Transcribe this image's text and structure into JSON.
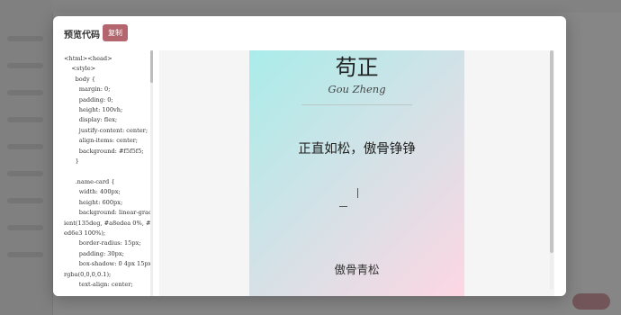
{
  "modal": {
    "title": "预览代码",
    "copy_label": "复制"
  },
  "code_lines": [
    "<html><head>",
    "    <style>",
    "      body {",
    "        margin: 0;",
    "        padding: 0;",
    "        height: 100vh;",
    "        display: flex;",
    "        justify-content: center;",
    "        align-items: center;",
    "        background: #f5f5f5;",
    "      }",
    "",
    "      .name-card {",
    "        width: 400px;",
    "        height: 600px;",
    "        background: linear-gradient(135deg, #a8edea 0%, #fed6e3 100%);",
    "        border-radius: 15px;",
    "        padding: 30px;",
    "        box-shadow: 0 4px 15px rgba(0,0,0,0.1);",
    "        text-align: center;"
  ],
  "card": {
    "name": "苟正",
    "pinyin": "Gou Zheng",
    "motto": "正直如松，傲骨铮铮",
    "footer": "傲骨青松"
  },
  "colors": {
    "copy_button": "#b3666e",
    "gradient_start": "#a8edea",
    "gradient_end": "#fed6e3",
    "preview_background": "#f5f5f5"
  }
}
